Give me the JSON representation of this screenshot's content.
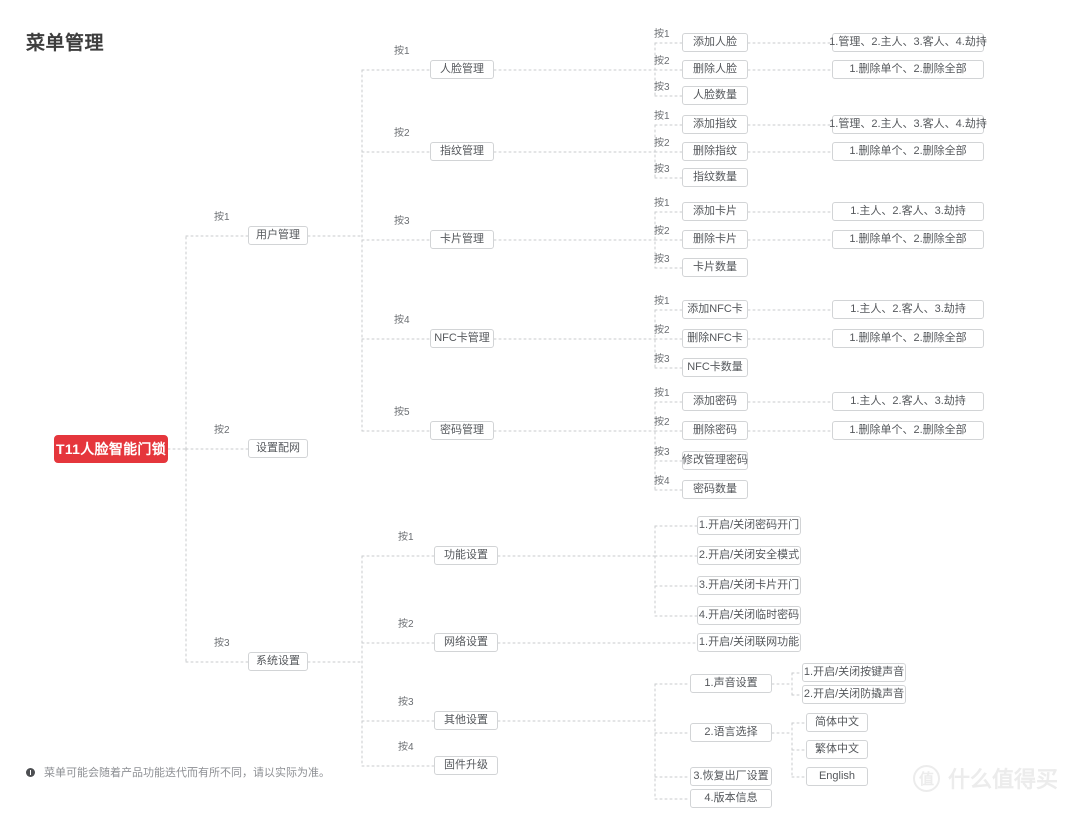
{
  "page": {
    "title": "菜单管理",
    "footnote": "菜单可能会随着产品功能迭代而有所不同，请以实际为准。",
    "watermark_badge": "值",
    "watermark_text": "什么值得买",
    "accent_color": "#e5363c",
    "box_border_color": "#d2d4d6",
    "text_color": "#55585c"
  },
  "root": {
    "label": "T11人脸智能门锁"
  },
  "level1": [
    {
      "key": "按1",
      "label": "用户管理"
    },
    {
      "key": "按2",
      "label": "设置配网"
    },
    {
      "key": "按3",
      "label": "系统设置"
    }
  ],
  "level2": [
    {
      "key": "按1",
      "label": "人脸管理"
    },
    {
      "key": "按2",
      "label": "指纹管理"
    },
    {
      "key": "按3",
      "label": "卡片管理"
    },
    {
      "key": "按4",
      "label": "NFC卡管理"
    },
    {
      "key": "按5",
      "label": "密码管理"
    },
    {
      "key": "按1",
      "label": "功能设置"
    },
    {
      "key": "按2",
      "label": "网络设置"
    },
    {
      "key": "按3",
      "label": "其他设置"
    },
    {
      "key": "按4",
      "label": "固件升级"
    }
  ],
  "level3": [
    {
      "key": "按1",
      "label": "添加人脸"
    },
    {
      "key": "按2",
      "label": "删除人脸"
    },
    {
      "key": "按3",
      "label": "人脸数量"
    },
    {
      "key": "按1",
      "label": "添加指纹"
    },
    {
      "key": "按2",
      "label": "删除指纹"
    },
    {
      "key": "按3",
      "label": "指纹数量"
    },
    {
      "key": "按1",
      "label": "添加卡片"
    },
    {
      "key": "按2",
      "label": "删除卡片"
    },
    {
      "key": "按3",
      "label": "卡片数量"
    },
    {
      "key": "按1",
      "label": "添加NFC卡"
    },
    {
      "key": "按2",
      "label": "删除NFC卡"
    },
    {
      "key": "按3",
      "label": "NFC卡数量"
    },
    {
      "key": "按1",
      "label": "添加密码"
    },
    {
      "key": "按2",
      "label": "删除密码"
    },
    {
      "key": "按3",
      "label": "修改管理密码"
    },
    {
      "key": "按4",
      "label": "密码数量"
    },
    {
      "key": "",
      "label": "1.开启/关闭密码开门"
    },
    {
      "key": "",
      "label": "2.开启/关闭安全模式"
    },
    {
      "key": "",
      "label": "3.开启/关闭卡片开门"
    },
    {
      "key": "",
      "label": "4.开启/关闭临时密码"
    },
    {
      "key": "",
      "label": "1.开启/关闭联网功能"
    },
    {
      "key": "",
      "label": "1.声音设置"
    },
    {
      "key": "",
      "label": "2.语言选择"
    },
    {
      "key": "",
      "label": "3.恢复出厂设置"
    },
    {
      "key": "",
      "label": "4.版本信息"
    }
  ],
  "level4": [
    {
      "label": "1.管理、2.主人、3.客人、4.劫持"
    },
    {
      "label": "1.删除单个、2.删除全部"
    },
    {
      "label": "1.管理、2.主人、3.客人、4.劫持"
    },
    {
      "label": "1.删除单个、2.删除全部"
    },
    {
      "label": "1.主人、2.客人、3.劫持"
    },
    {
      "label": "1.删除单个、2.删除全部"
    },
    {
      "label": "1.主人、2.客人、3.劫持"
    },
    {
      "label": "1.删除单个、2.删除全部"
    },
    {
      "label": "1.主人、2.客人、3.劫持"
    },
    {
      "label": "1.删除单个、2.删除全部"
    },
    {
      "label": "1.开启/关闭按键声音"
    },
    {
      "label": "2.开启/关闭防撬声音"
    },
    {
      "label": "简体中文"
    },
    {
      "label": "繁体中文"
    },
    {
      "label": "English"
    }
  ]
}
